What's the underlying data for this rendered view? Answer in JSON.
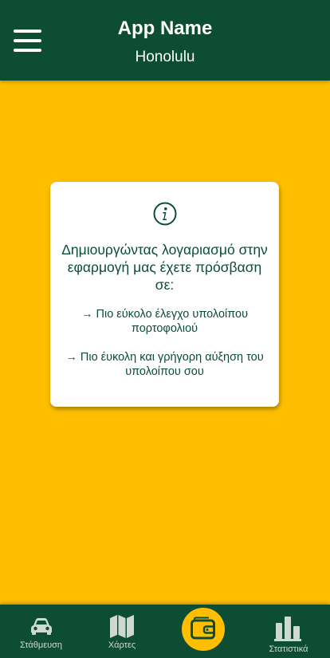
{
  "header": {
    "app_name": "App Name",
    "city": "Honolulu",
    "menu_icon": "hamburger-menu-icon"
  },
  "card": {
    "icon": "info-icon",
    "heading": "Δημιουργώντας λογαριασμό στην εφαρμογή μας έχετε πρόσβαση σε:",
    "bullets": [
      "→ Πιο εύκολο έλεγχο υπολοίπου πορτοφολιού",
      "→ Πιο έυκολη και γρήγορη αύξηση του υπολοίπου σου"
    ]
  },
  "nav": {
    "items": [
      {
        "label": "Στάθμευση",
        "icon": "car-icon"
      },
      {
        "label": "Χάρτες",
        "icon": "map-icon"
      },
      {
        "label": "",
        "icon": "wallet-icon"
      },
      {
        "label": "Στατιστικά",
        "icon": "bar-chart-icon"
      }
    ]
  },
  "colors": {
    "primary": "#0d4d33",
    "accent": "#ffbf00",
    "background": "#ffbf00",
    "card": "#ffffff"
  }
}
